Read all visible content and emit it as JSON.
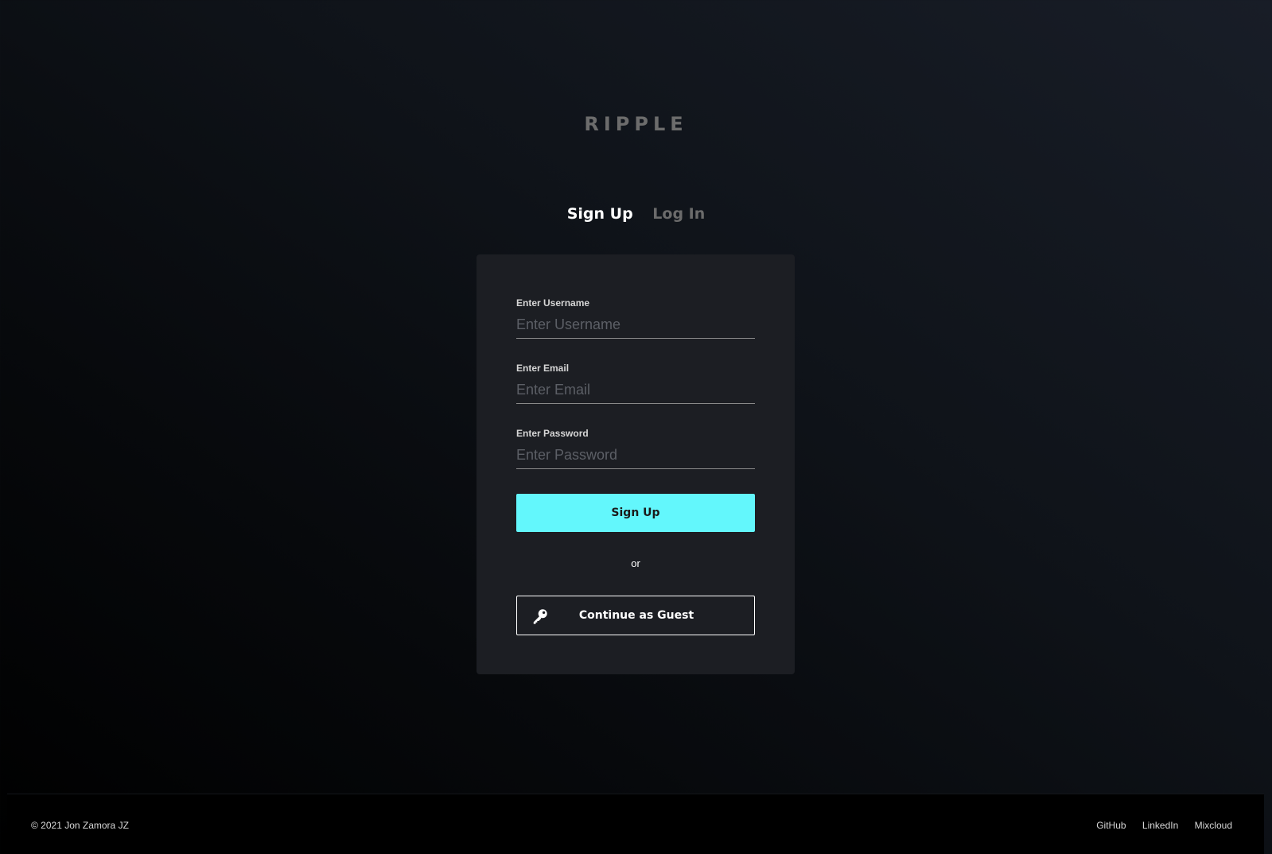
{
  "app": {
    "logo_text": "RIPPLE"
  },
  "auth_tabs": {
    "signup_label": "Sign Up",
    "login_label": "Log In",
    "active": "signup"
  },
  "form": {
    "username": {
      "label": "Enter Username",
      "placeholder": "Enter Username",
      "value": ""
    },
    "email": {
      "label": "Enter Email",
      "placeholder": "Enter Email",
      "value": ""
    },
    "password": {
      "label": "Enter Password",
      "placeholder": "Enter Password",
      "value": ""
    },
    "submit_label": "Sign Up",
    "divider_text": "or",
    "guest_label": "Continue as Guest",
    "guest_icon": "key-icon"
  },
  "footer": {
    "copyright": "© 2021 Jon Zamora JZ",
    "links": [
      "GitHub",
      "LinkedIn",
      "Mixcloud"
    ]
  },
  "colors": {
    "accent": "#63f7fc",
    "card_background": "#1c1e23",
    "footer_background": "#000000"
  }
}
